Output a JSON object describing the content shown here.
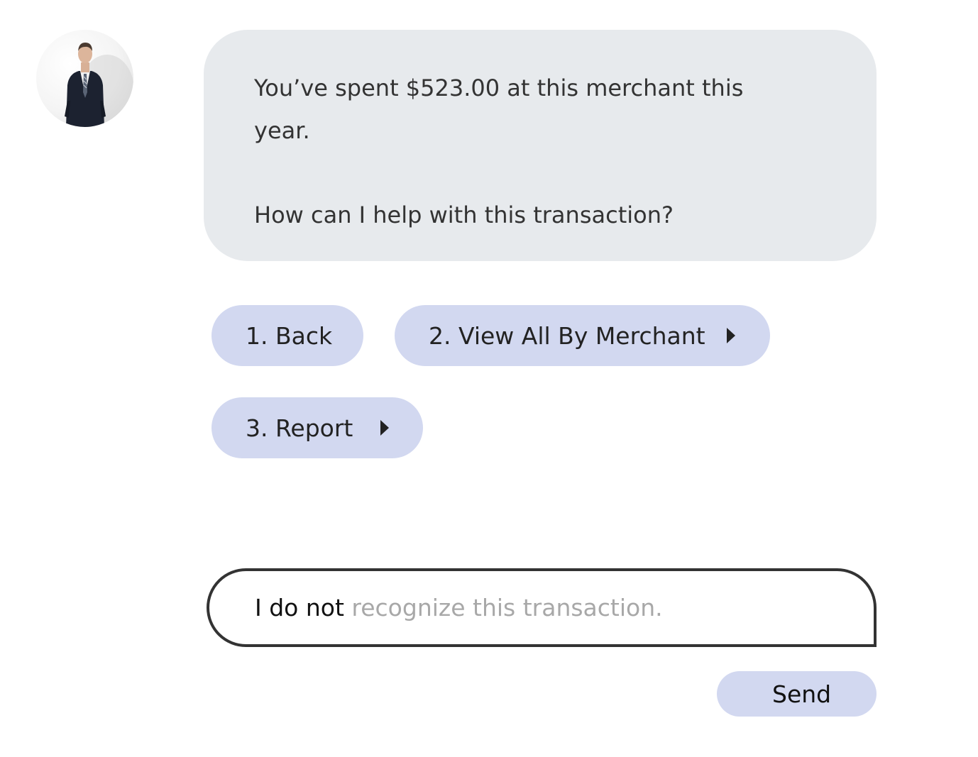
{
  "bot": {
    "avatar_icon": "businessman-avatar-icon",
    "message_line1": "You’ve spent $523.00 at this merchant this year.",
    "message_line2": "How can I help with this transaction?"
  },
  "quick_replies": [
    {
      "label": "1. Back"
    },
    {
      "label": "2. View All By Merchant",
      "icon": "caret-right-icon"
    },
    {
      "label": "3. Report",
      "icon": "caret-right-icon"
    }
  ],
  "composer": {
    "typed_text": "I do not ",
    "suggestion_text": "recognize this transaction.",
    "send_label": "Send"
  },
  "colors": {
    "bubble_bg": "#e7eaed",
    "chip_bg": "#d2d8f0",
    "input_border": "#333333",
    "suggestion_text": "#a8a8a8"
  }
}
